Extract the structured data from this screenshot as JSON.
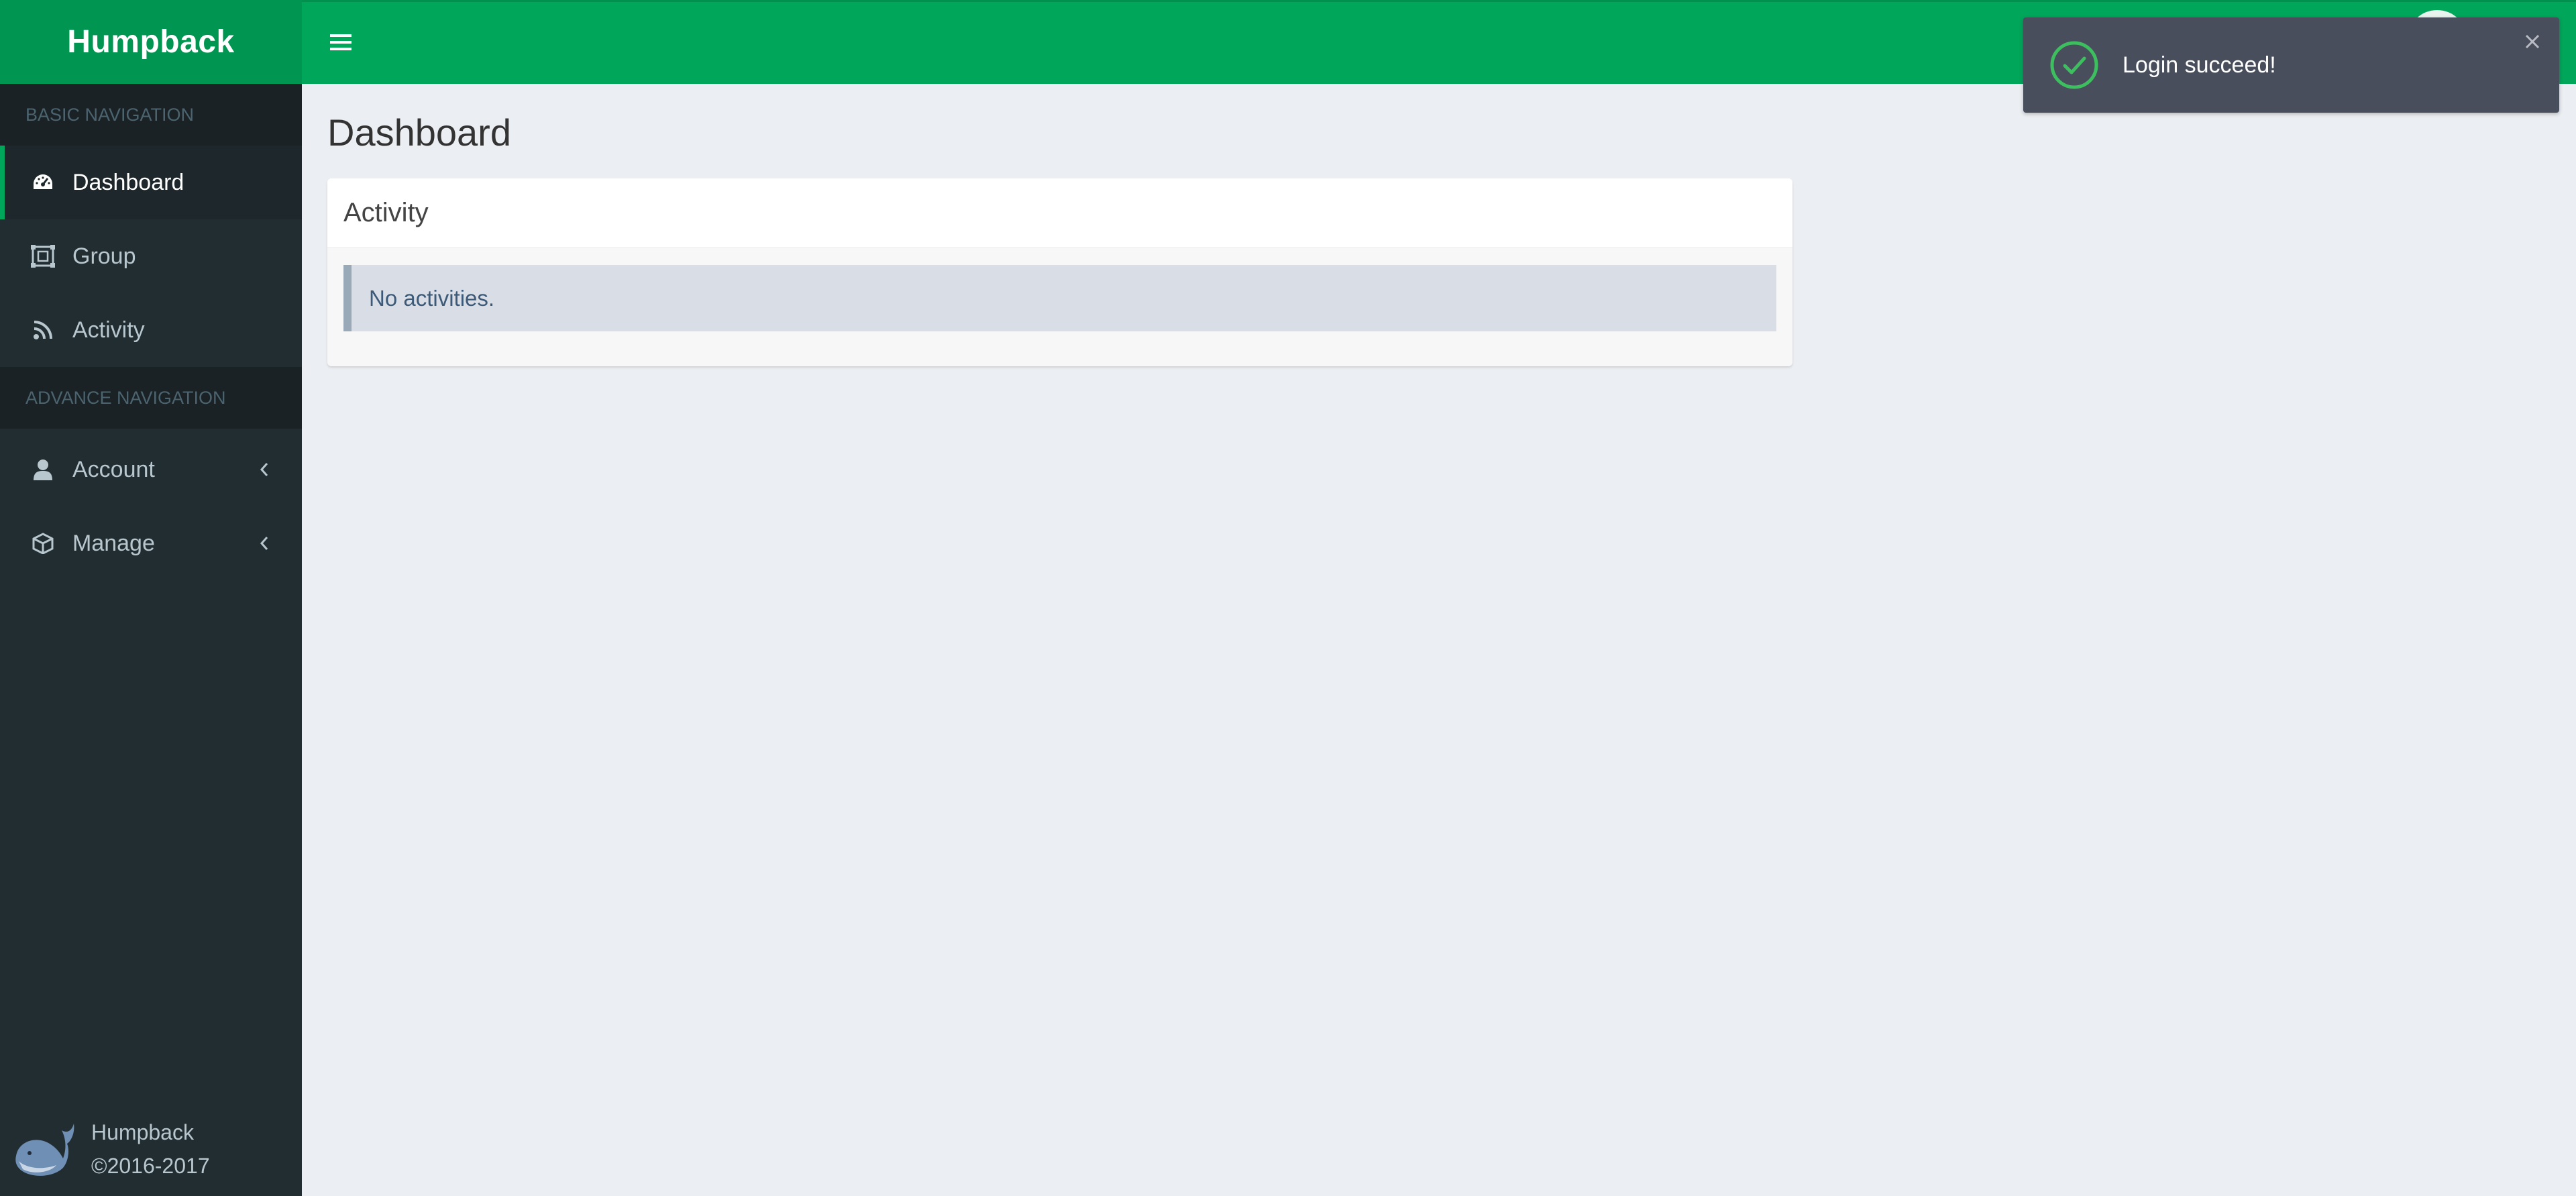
{
  "brand": {
    "name": "Humpback"
  },
  "sidebar": {
    "sections": [
      {
        "header": "BASIC NAVIGATION",
        "items": [
          {
            "label": "Dashboard",
            "icon": "dashboard-gauge-icon",
            "active": true
          },
          {
            "label": "Group",
            "icon": "group-frame-icon"
          },
          {
            "label": "Activity",
            "icon": "rss-feed-icon"
          }
        ]
      },
      {
        "header": "ADVANCE NAVIGATION",
        "items": [
          {
            "label": "Account",
            "icon": "user-icon",
            "expandable": true
          },
          {
            "label": "Manage",
            "icon": "cube-icon",
            "expandable": true
          }
        ]
      }
    ],
    "footer": {
      "name": "Humpback",
      "copyright": "©2016-2017"
    }
  },
  "header": {
    "menu_toggle_icon": "hamburger-menu-icon"
  },
  "main": {
    "page_title": "Dashboard",
    "activity_box": {
      "title": "Activity",
      "empty_message": "No activities."
    }
  },
  "toast": {
    "message": "Login succeed!",
    "icon": "success-check-icon",
    "close_icon": "close-icon"
  },
  "colors": {
    "brand_green": "#00a65a",
    "brand_green_dark": "#009551",
    "sidebar_bg": "#222d32",
    "toast_bg": "#494e5c",
    "success": "#3dbf5f"
  }
}
